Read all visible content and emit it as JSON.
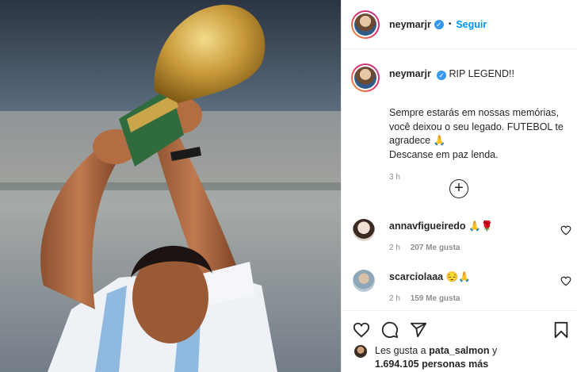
{
  "post": {
    "username": "neymarjr",
    "follow_label": "Seguir",
    "dot": "•",
    "verified_mark": "✓",
    "caption_title": "RIP LEGEND!!",
    "caption_body": "Sempre estarás em nossas memórias,\nvocê deixou o seu legado. FUTEBOL te\nagradece 🙏\nDescanse em paz lenda.",
    "time": "3 h",
    "load_more_icon": "+"
  },
  "comments": [
    {
      "user": "annavfigueiredo",
      "text": "🙏🌹",
      "time": "2 h",
      "likes": "207 Me gusta"
    },
    {
      "user": "scarciolaaa",
      "text": "😔🙏",
      "time": "2 h",
      "likes": "159 Me gusta"
    }
  ],
  "likes": {
    "prefix": "Les gusta a",
    "user": "pata_salmon",
    "connector": "y",
    "count": "1.694.105 personas más"
  },
  "icons": {
    "heart": "heart-icon",
    "comment": "comment-icon",
    "share": "share-icon",
    "save": "bookmark-icon"
  },
  "colors": {
    "accent": "#0095f6",
    "verified": "#3897f0",
    "text": "#262626",
    "muted": "#8e8e8e"
  }
}
